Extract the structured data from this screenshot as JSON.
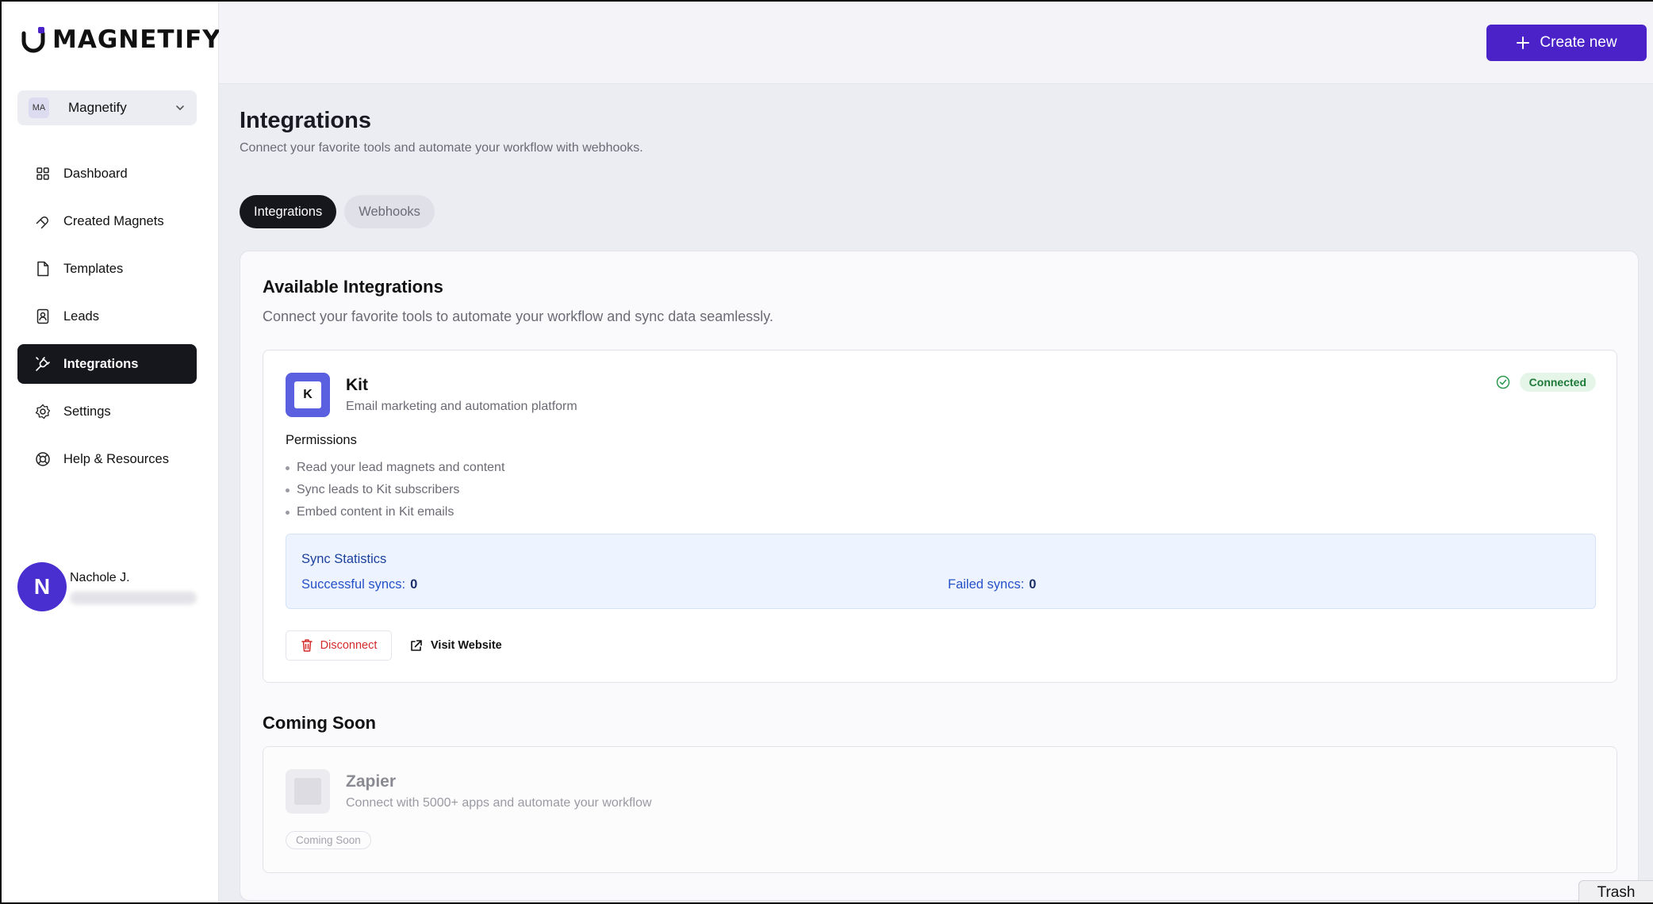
{
  "brand": {
    "name": "MAGNETIFY",
    "accent": "#4a22c8"
  },
  "workspace": {
    "badge": "MA",
    "name": "Magnetify"
  },
  "sidebar": {
    "items": [
      {
        "label": "Dashboard",
        "icon": "grid-icon"
      },
      {
        "label": "Created Magnets",
        "icon": "magnet-icon"
      },
      {
        "label": "Templates",
        "icon": "document-icon"
      },
      {
        "label": "Leads",
        "icon": "contacts-icon"
      },
      {
        "label": "Integrations",
        "icon": "plug-icon",
        "active": true
      },
      {
        "label": "Settings",
        "icon": "gear-icon"
      },
      {
        "label": "Help & Resources",
        "icon": "lifebuoy-icon"
      }
    ]
  },
  "user": {
    "initial": "N",
    "name": "Nachole J."
  },
  "topbar": {
    "create_label": "Create new"
  },
  "page": {
    "title": "Integrations",
    "subtitle": "Connect your favorite tools and automate your workflow with webhooks."
  },
  "tabs": [
    {
      "label": "Integrations",
      "active": true
    },
    {
      "label": "Webhooks",
      "active": false
    }
  ],
  "available": {
    "title": "Available Integrations",
    "subtitle": "Connect your favorite tools to automate your workflow and sync data seamlessly."
  },
  "kit": {
    "logo_letter": "K",
    "name": "Kit",
    "description": "Email marketing and automation platform",
    "status": "Connected",
    "permissions_title": "Permissions",
    "permissions": [
      "Read your lead magnets and content",
      "Sync leads to Kit subscribers",
      "Embed content in Kit emails"
    ],
    "stats": {
      "title": "Sync Statistics",
      "successful_label": "Successful syncs:",
      "successful_value": "0",
      "failed_label": "Failed syncs:",
      "failed_value": "0"
    },
    "disconnect_label": "Disconnect",
    "visit_label": "Visit Website"
  },
  "coming_soon": {
    "title": "Coming Soon",
    "zapier": {
      "name": "Zapier",
      "description": "Connect with 5000+ apps and automate your workflow",
      "badge": "Coming Soon"
    }
  },
  "trash_label": "Trash"
}
